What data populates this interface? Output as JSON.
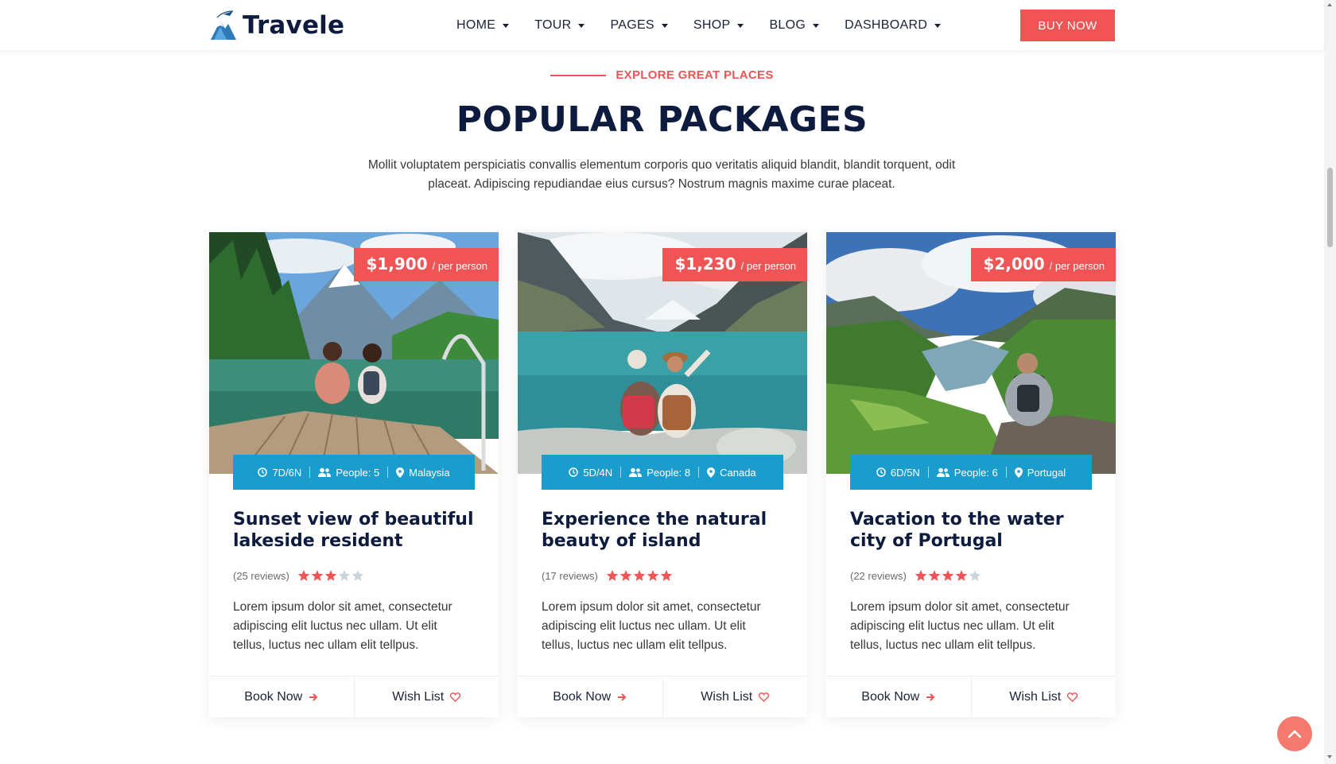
{
  "brand": {
    "name": "Travele"
  },
  "nav": {
    "items": [
      {
        "label": "HOME"
      },
      {
        "label": "TOUR"
      },
      {
        "label": "PAGES"
      },
      {
        "label": "SHOP"
      },
      {
        "label": "BLOG"
      },
      {
        "label": "DASHBOARD"
      }
    ],
    "cta_label": "BUY NOW"
  },
  "section": {
    "eyebrow": "EXPLORE GREAT PLACES",
    "title": "POPULAR PACKAGES",
    "description": "Mollit voluptatem perspiciatis convallis elementum corporis quo veritatis aliquid blandit, blandit torquent, odit placeat. Adipiscing repudiandae eius cursus? Nostrum magnis maxime curae placeat."
  },
  "packages": [
    {
      "price": "$1,900",
      "price_unit": "/ per person",
      "duration": "7D/6N",
      "people": "People: 5",
      "location": "Malaysia",
      "title": "Sunset view of beautiful lakeside resident",
      "reviews": "(25 reviews)",
      "rating": 3,
      "description": "Lorem ipsum dolor sit amet, consectetur adipiscing elit luctus nec ullam. Ut elit tellus, luctus nec ullam elit tellpus.",
      "book_label": "Book Now",
      "wish_label": "Wish List"
    },
    {
      "price": "$1,230",
      "price_unit": "/ per person",
      "duration": "5D/4N",
      "people": "People: 8",
      "location": "Canada",
      "title": "Experience the natural beauty of island",
      "reviews": "(17 reviews)",
      "rating": 5,
      "description": "Lorem ipsum dolor sit amet, consectetur adipiscing elit luctus nec ullam. Ut elit tellus, luctus nec ullam elit tellpus.",
      "book_label": "Book Now",
      "wish_label": "Wish List"
    },
    {
      "price": "$2,000",
      "price_unit": "/ per person",
      "duration": "6D/5N",
      "people": "People: 6",
      "location": "Portugal",
      "title": "Vacation to the water city of Portugal",
      "reviews": "(22 reviews)",
      "rating": 4,
      "description": "Lorem ipsum dolor sit amet, consectetur adipiscing elit luctus nec ullam. Ut elit tellus, luctus nec ullam elit tellpus.",
      "book_label": "Book Now",
      "wish_label": "Wish List"
    }
  ],
  "colors": {
    "accent": "#f05454",
    "meta_bar": "#1a9ccd",
    "heading": "#0d1b3e",
    "star_empty": "#c9d3dc"
  }
}
